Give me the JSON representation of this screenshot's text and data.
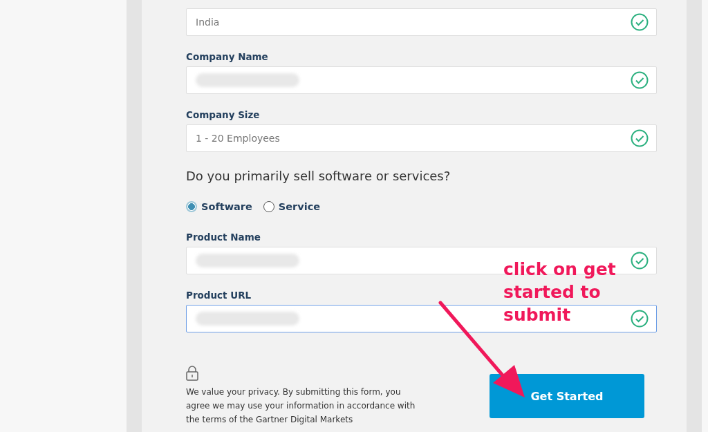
{
  "form": {
    "fields": [
      {
        "value": "India",
        "valid": true,
        "focused": false
      },
      {
        "label": "Company Name",
        "valid": true,
        "redacted": true,
        "focused": false
      },
      {
        "label": "Company Size",
        "value": "1 - 20 Employees",
        "valid": true,
        "focused": false
      }
    ],
    "question": "Do you primarily sell software or services?",
    "options": [
      {
        "label": "Software",
        "selected": true
      },
      {
        "label": "Service",
        "selected": false
      }
    ],
    "product_fields": [
      {
        "label": "Product Name",
        "valid": true,
        "redacted": true,
        "focused": false
      },
      {
        "label": "Product URL",
        "valid": true,
        "redacted": true,
        "focused": true
      }
    ],
    "privacy_text": "We value your privacy. By submitting this form, you agree we may use your information in accordance with the terms of the Gartner Digital Markets",
    "submit_button": "Get Started"
  },
  "annotation": {
    "text": "click on get started to submit"
  }
}
